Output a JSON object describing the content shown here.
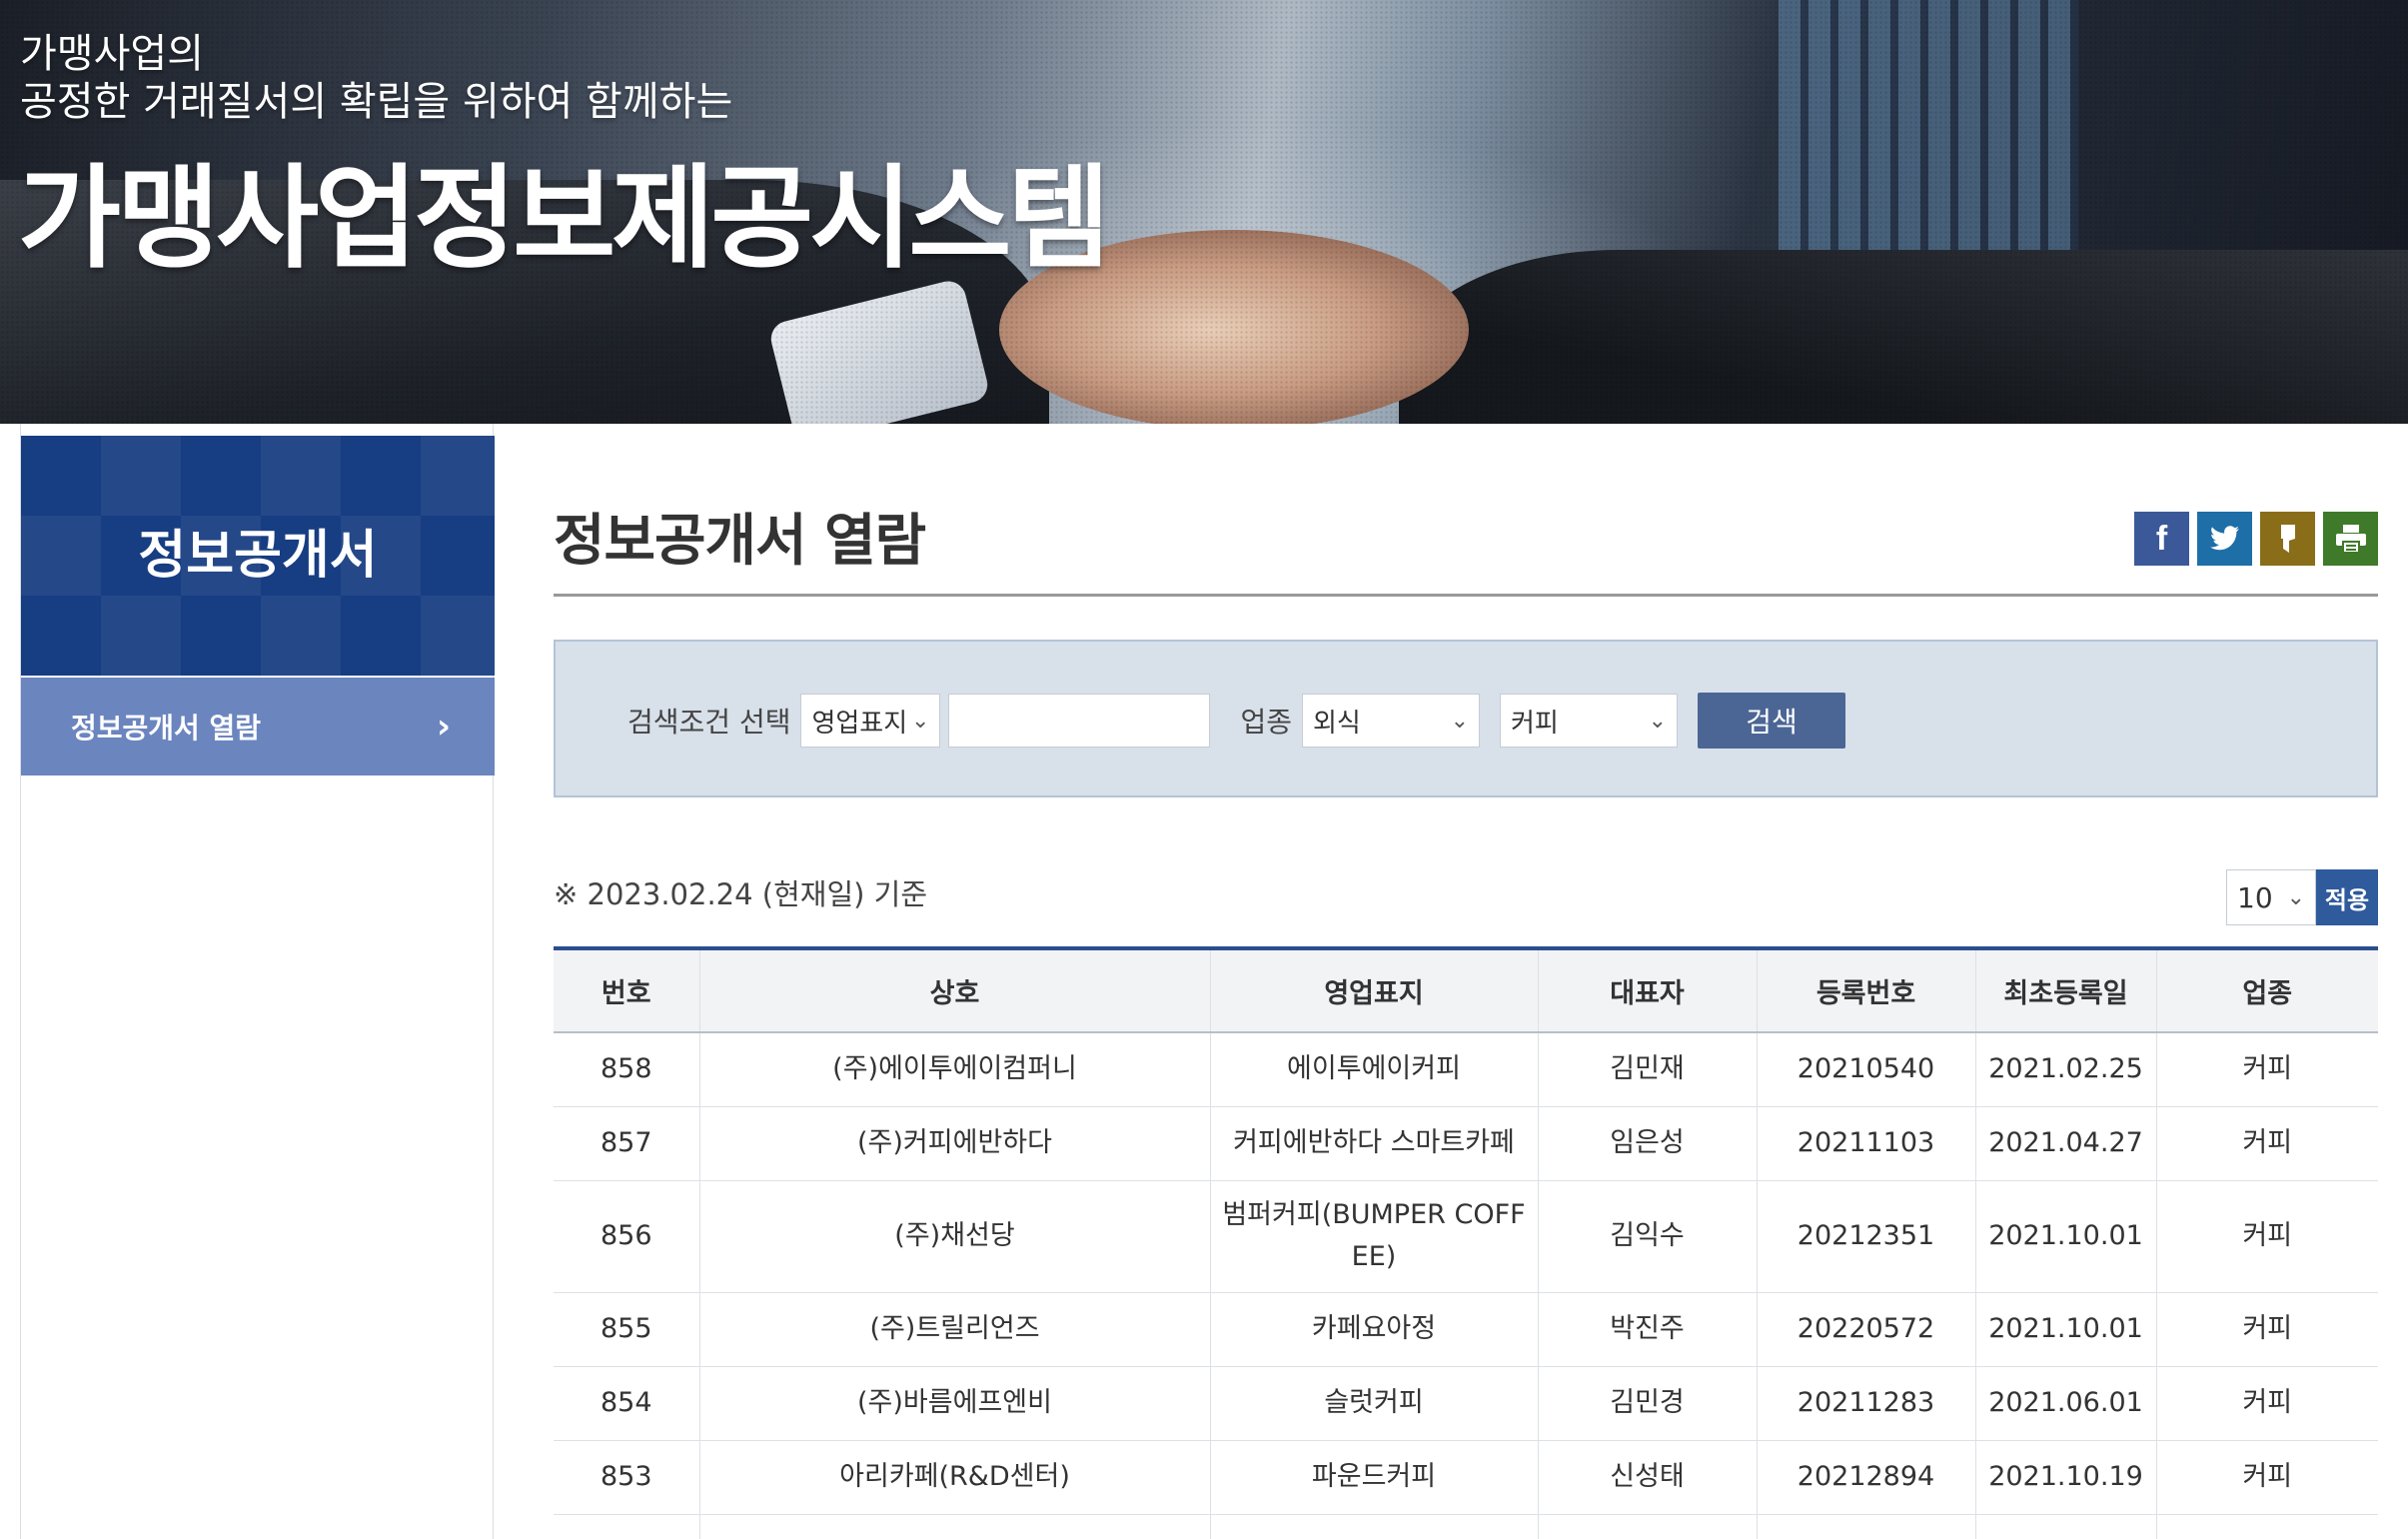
{
  "banner": {
    "slogan_line1": "가맹사업의",
    "slogan_line2": "공정한 거래질서의 확립을 위하여 함께하는",
    "title": "가맹사업정보제공시스템"
  },
  "sidebar": {
    "heading": "정보공개서",
    "items": [
      {
        "label": "정보공개서 열람",
        "icon": "chevron-right-icon"
      }
    ]
  },
  "main": {
    "page_title": "정보공개서 열람",
    "share_icons": [
      "facebook-icon",
      "twitter-icon",
      "kakaostory-icon",
      "print-icon"
    ],
    "search": {
      "condition_label": "검색조건 선택",
      "condition_value": "영업표지",
      "keyword_value": "",
      "industry_label": "업종",
      "industry_value": "외식",
      "subindustry_value": "커피",
      "button_label": "검색"
    },
    "date_note": "※ 2023.02.24 (현재일) 기준",
    "page_size": {
      "value": "10",
      "apply_label": "적용"
    },
    "table": {
      "headers": [
        "번호",
        "상호",
        "영업표지",
        "대표자",
        "등록번호",
        "최초등록일",
        "업종"
      ],
      "rows": [
        {
          "no": "858",
          "company": "(주)에이투에이컴퍼니",
          "brand": "에이투에이커피",
          "ceo": "김민재",
          "reg_no": "20210540",
          "first_reg": "2021.02.25",
          "industry": "커피"
        },
        {
          "no": "857",
          "company": "(주)커피에반하다",
          "brand": "커피에반하다 스마트카페",
          "ceo": "임은성",
          "reg_no": "20211103",
          "first_reg": "2021.04.27",
          "industry": "커피"
        },
        {
          "no": "856",
          "company": "(주)채선당",
          "brand": "범퍼커피(BUMPER COFFEE)",
          "ceo": "김익수",
          "reg_no": "20212351",
          "first_reg": "2021.10.01",
          "industry": "커피"
        },
        {
          "no": "855",
          "company": "(주)트릴리언즈",
          "brand": "카페요아정",
          "ceo": "박진주",
          "reg_no": "20220572",
          "first_reg": "2021.10.01",
          "industry": "커피"
        },
        {
          "no": "854",
          "company": "(주)바름에프엔비",
          "brand": "슬럿커피",
          "ceo": "김민경",
          "reg_no": "20211283",
          "first_reg": "2021.06.01",
          "industry": "커피"
        },
        {
          "no": "853",
          "company": "아리카페(R&D센터)",
          "brand": "파운드커피",
          "ceo": "신성태",
          "reg_no": "20212894",
          "first_reg": "2021.10.19",
          "industry": "커피"
        }
      ]
    }
  }
}
